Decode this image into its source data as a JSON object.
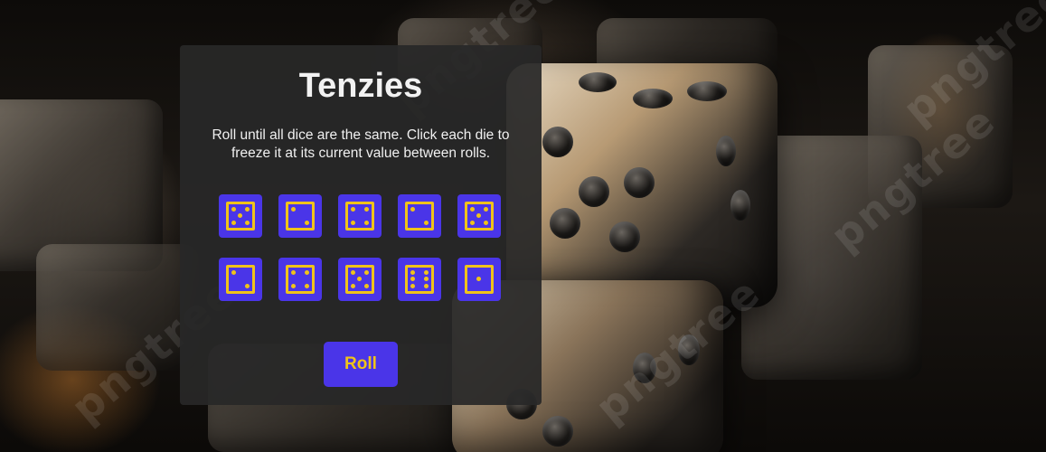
{
  "app": {
    "title": "Tenzies",
    "instructions": "Roll until all dice are the same. Click each die to freeze it at its current value between rolls."
  },
  "dice": [
    {
      "value": 5,
      "held": false
    },
    {
      "value": 2,
      "held": false
    },
    {
      "value": 4,
      "held": false
    },
    {
      "value": 2,
      "held": false
    },
    {
      "value": 5,
      "held": false
    },
    {
      "value": 2,
      "held": false
    },
    {
      "value": 4,
      "held": false
    },
    {
      "value": 5,
      "held": false
    },
    {
      "value": 6,
      "held": false
    },
    {
      "value": 1,
      "held": false
    }
  ],
  "controls": {
    "roll_label": "Roll"
  },
  "colors": {
    "die_background": "#4a35e8",
    "pip_color": "#f0c31a",
    "panel_background": "#282828",
    "button_background": "#4a35e8",
    "button_text": "#f0c31a"
  },
  "background": {
    "watermark_text": "pngtree"
  }
}
